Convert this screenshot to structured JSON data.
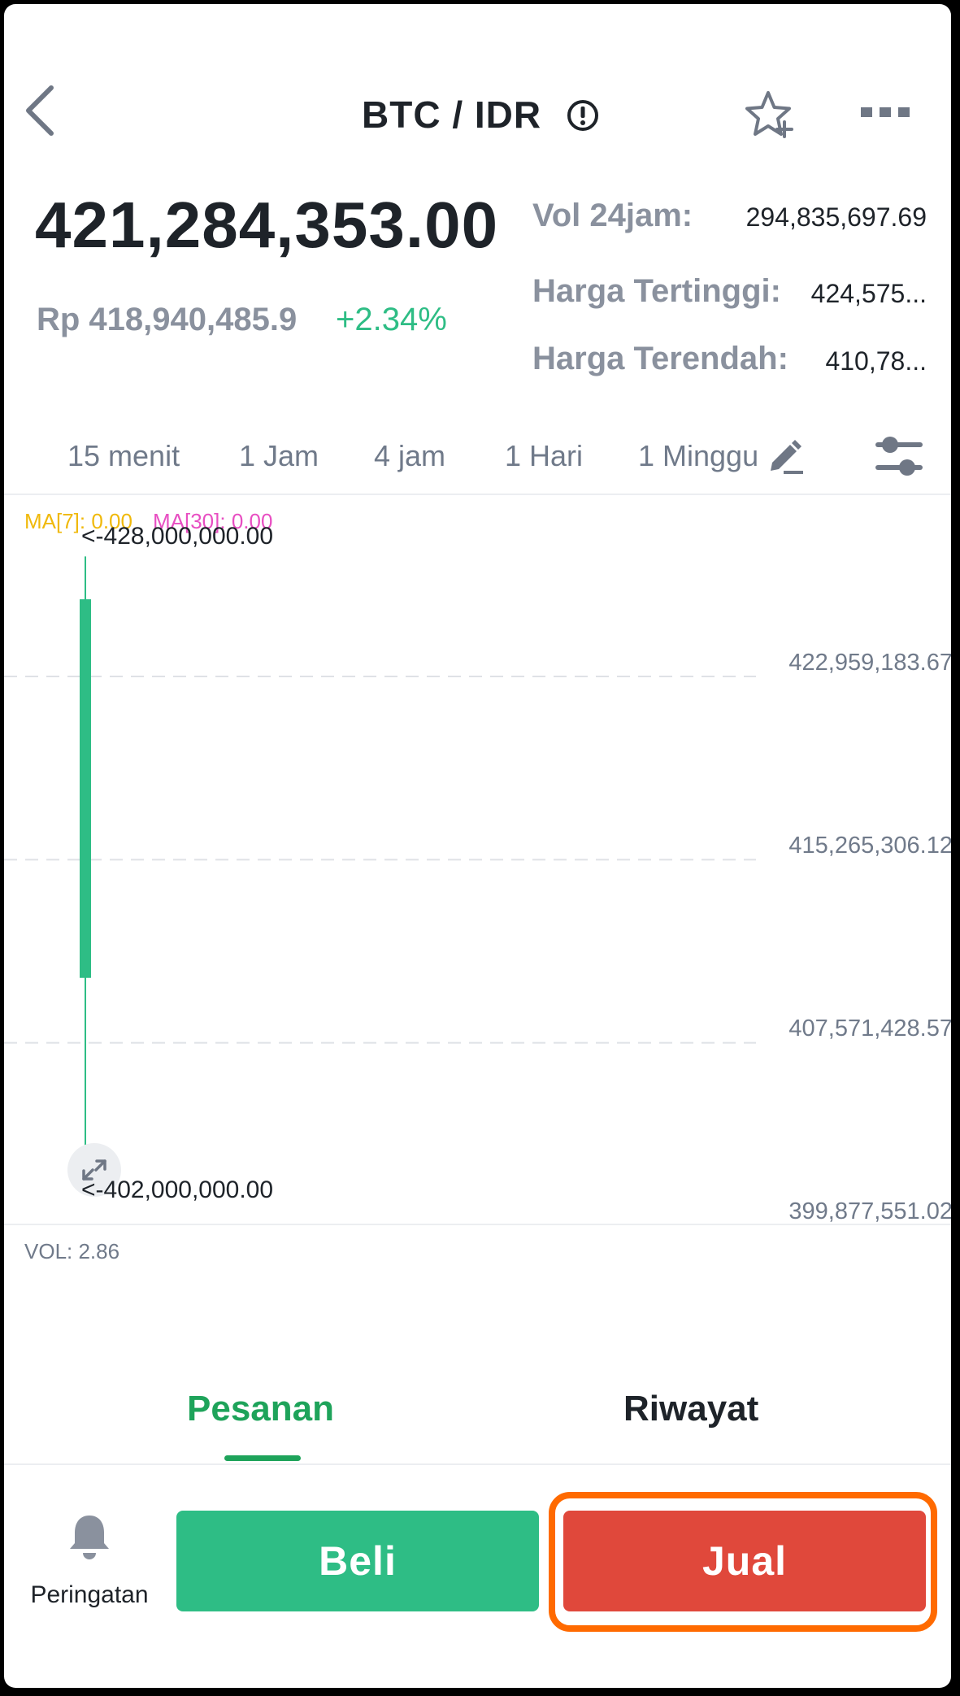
{
  "header": {
    "pair": "BTC / IDR",
    "back_icon": "chevron-left-icon",
    "info_icon": "info-circle-icon",
    "favorite_icon": "star-plus-icon",
    "more_icon": "more-dots-icon"
  },
  "price": {
    "last": "421,284,353.00",
    "idr_equivalent": "Rp 418,940,485.9",
    "change_percent": "+2.34%"
  },
  "stats": {
    "volume_label": "Vol 24jam:",
    "volume_value": "294,835,697.69",
    "high_label": "Harga Tertinggi:",
    "high_value": "424,575...",
    "low_label": "Harga Terendah:",
    "low_value": "410,78..."
  },
  "intervals": [
    "15 menit",
    "1 Jam",
    "4 jam",
    "1 Hari",
    "1 Minggu"
  ],
  "chart_tools": {
    "draw_icon": "pencil-draw-icon",
    "settings_icon": "sliders-icon"
  },
  "chart_data": {
    "type": "candlestick",
    "indicators": {
      "ma7_label": "MA[7]: 0.00",
      "ma30_label": "MA[30]: 0.00"
    },
    "y_ticks": [
      "422,959,183.67",
      "415,265,306.12",
      "407,571,428.57",
      "399,877,551.02"
    ],
    "y_tick_values": [
      422959183.67,
      415265306.12,
      407571428.57,
      399877551.02
    ],
    "high_annotation": "<-428,000,000.00",
    "low_annotation": "<-402,000,000.00",
    "candles": [
      {
        "open": 410300000,
        "close": 426200000,
        "high": 428000000,
        "low": 402000000
      }
    ],
    "volume_label": "VOL: 2.86",
    "grid": "dashed-horizontal",
    "colors": {
      "up": "#2ebd85",
      "ma7": "#f0b90b",
      "ma30": "#e84fc2"
    }
  },
  "expand_icon": "expand-arrows-icon",
  "section_tabs": [
    "Pesanan",
    "Riwayat"
  ],
  "bottom_bar": {
    "alert_label": "Peringatan",
    "alert_icon": "bell-icon",
    "buy_label": "Beli",
    "sell_label": "Jual"
  },
  "colors": {
    "buy": "#2ebd85",
    "sell": "#e0483b",
    "highlight": "#ff6a00",
    "active_tab": "#1ea35a"
  }
}
